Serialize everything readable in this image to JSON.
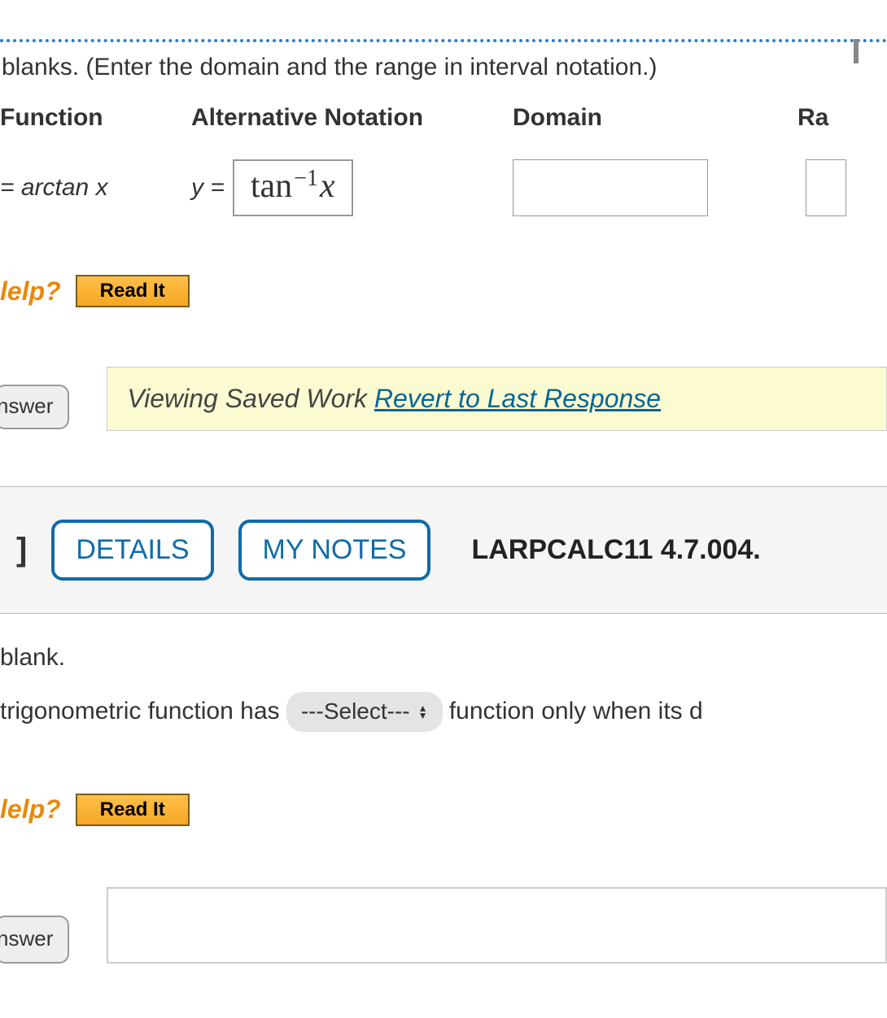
{
  "section1": {
    "instruction": "blanks. (Enter the domain and the range in interval notation.)",
    "headers": {
      "function": "Function",
      "alternative": "Alternative Notation",
      "domain": "Domain",
      "range": "Ra"
    },
    "row": {
      "function": "= arctan x",
      "alt_prefix": "y =",
      "alt_tan": "tan",
      "alt_exp": "−1",
      "alt_x": "x"
    },
    "help_label": "lelp?",
    "read_it": "Read It",
    "answer_tab": "nswer",
    "saved_bar_text": "Viewing Saved Work ",
    "saved_bar_link": "Revert to Last Response"
  },
  "section2": {
    "q_num": "]",
    "details": "DETAILS",
    "my_notes": "MY NOTES",
    "book_ref": "LARPCALC11 4.7.004.",
    "blank": "blank.",
    "sentence_start": "trigonometric function has ",
    "select_label": "---Select---",
    "sentence_end": " function only when its d",
    "help_label": "lelp?",
    "read_it": "Read It",
    "answer_tab": "nswer"
  }
}
